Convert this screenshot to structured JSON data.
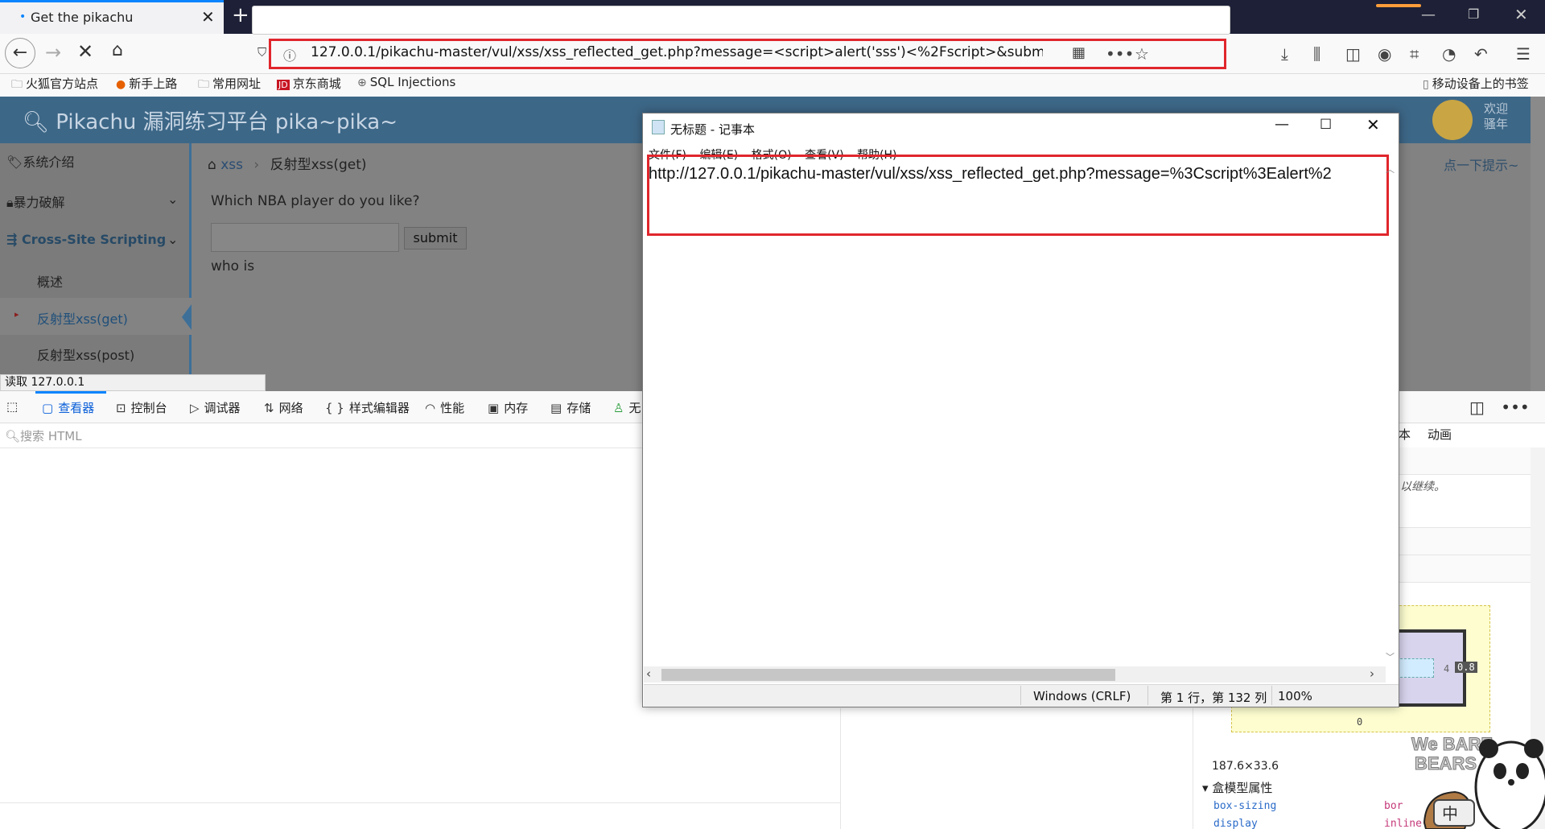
{
  "browser": {
    "tab_title": "Get the pikachu",
    "tab_dot": "•",
    "tab_close": "✕",
    "new_tab": "+",
    "url": "127.0.0.1/pikachu-master/vul/xss/xss_reflected_get.php?message=<script>alert('sss')<%2Fscript>&submit=su",
    "window_min": "—",
    "window_max": "❐",
    "window_close": "✕",
    "bookmarks": [
      "火狐官方站点",
      "新手上路",
      "常用网址",
      "京东商城",
      "SQL Injections"
    ],
    "mobile_bookmarks": "移动设备上的书签",
    "status": "读取 127.0.0.1"
  },
  "page": {
    "brand": "Pikachu 漏洞练习平台 pika~pika~",
    "welcome_line1": "欢迎",
    "welcome_line2": "骚年",
    "hint": "点一下提示~",
    "sidebar": {
      "items": [
        "系统介绍",
        "暴力破解",
        "Cross-Site Scripting"
      ],
      "subitems": [
        "概述",
        "反射型xss(get)",
        "反射型xss(post)"
      ]
    },
    "breadcrumb": {
      "root": "xss",
      "sep": "›",
      "current": "反射型xss(get)"
    },
    "question": "Which NBA player do you like?",
    "submit_label": "submit",
    "result": "who is"
  },
  "devtools": {
    "tabs": [
      "查看器",
      "控制台",
      "调试器",
      "网络",
      "样式编辑器",
      "性能",
      "内存",
      "存储",
      "无"
    ],
    "search_placeholder": "搜索 HTML",
    "right_tabs": [
      "本",
      "动画"
    ],
    "note": "以继续。",
    "box_values": {
      "right": "4",
      "badge": "0.8",
      "bottom": "0"
    },
    "dimensions": "187.6×33.6",
    "section": "盒模型属性",
    "props": [
      {
        "name": "box-sizing",
        "value": "bor"
      },
      {
        "name": "display",
        "value": "inline-block"
      }
    ]
  },
  "notepad": {
    "title": "无标题 - 记事本",
    "menu": [
      "文件(F)",
      "编辑(E)",
      "格式(O)",
      "查看(V)",
      "帮助(H)"
    ],
    "content": "http://127.0.0.1/pikachu-master/vul/xss/xss_reflected_get.php?message=%3Cscript%3Ealert%2",
    "status_encoding": "Windows (CRLF)",
    "status_position": "第 1 行，第 132 列",
    "status_zoom": "100%"
  },
  "sticker": {
    "text1": "We BARE",
    "text2": "BEARS",
    "badge": "中"
  },
  "colors": {
    "accent": "#0a84ff",
    "highlight": "#e0262c",
    "header": "#3d6787"
  }
}
